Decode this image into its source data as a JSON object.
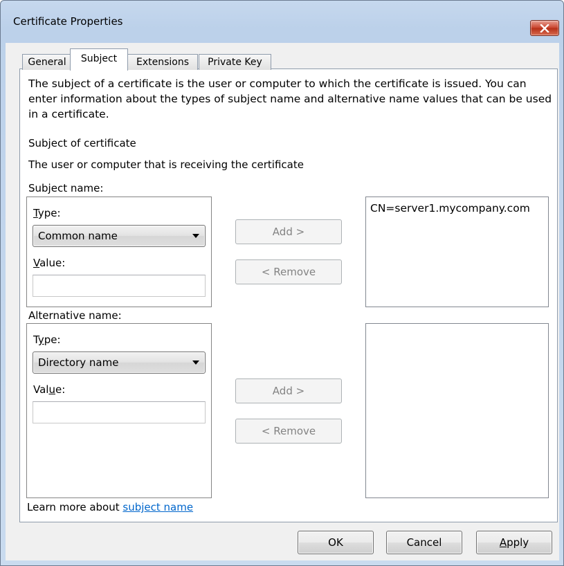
{
  "window": {
    "title": "Certificate Properties"
  },
  "tabs": [
    {
      "label": "General"
    },
    {
      "label": "Subject"
    },
    {
      "label": "Extensions"
    },
    {
      "label": "Private Key"
    }
  ],
  "description": "The subject of a certificate is the user or computer to which the certificate is issued. You can enter information about the types of subject name and alternative name values that can be used in a certificate.",
  "subject_section": {
    "heading": "Subject of certificate",
    "subheading": "The user or computer that is receiving the certificate"
  },
  "subject_name": {
    "group_label": "Subject name:",
    "type_label": "Type:",
    "type_value": "Common name",
    "value_label": "Value:",
    "value": "",
    "add_label": "Add >",
    "remove_label": "< Remove",
    "entries": [
      "CN=server1.mycompany.com"
    ]
  },
  "alternative_name": {
    "group_label": "Alternative name:",
    "type_label": "Type:",
    "type_value": "Directory name",
    "value_label": "Value:",
    "value": "",
    "add_label": "Add >",
    "remove_label": "< Remove",
    "entries": []
  },
  "learn_more": {
    "prefix": "Learn more about ",
    "link": "subject name"
  },
  "footer": {
    "ok_label": "OK",
    "cancel_label": "Cancel",
    "apply_label": "Apply"
  },
  "colors": {
    "link": "#0066cc",
    "close_button": "#c9432c",
    "disabled_text": "#838383"
  }
}
